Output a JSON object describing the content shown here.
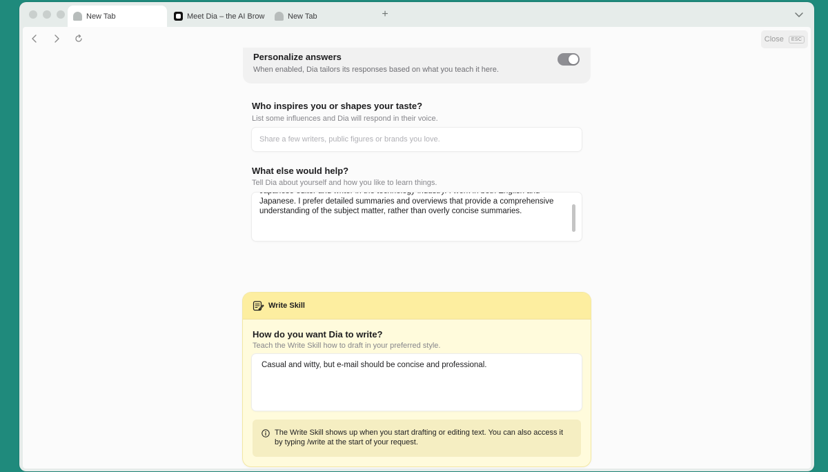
{
  "tabs": [
    {
      "label": "New Tab",
      "icon": "ghost-icon",
      "active": true
    },
    {
      "label": "Meet Dia – the AI Brow",
      "icon": "dia-icon",
      "active": false
    },
    {
      "label": "New Tab",
      "icon": "ghost-icon",
      "active": false
    }
  ],
  "new_tab_symbol": "+",
  "toolbar": {
    "close_label": "Close",
    "esc_key": "ESC"
  },
  "personalize": {
    "title": "Personalize answers",
    "description": "When enabled, Dia tailors its responses based on what you teach it here.",
    "enabled": true
  },
  "inspires": {
    "title": "Who inspires you or shapes your taste?",
    "subtitle": "List some influences and Dia will respond in their voice.",
    "placeholder": "Share a few writers, public figures or brands you love.",
    "value": ""
  },
  "else_help": {
    "title": "What else would help?",
    "subtitle": "Tell Dia about yourself and how you like to learn things.",
    "value": "Japanese editor and writer in the technology industry. I work in both English and Japanese. I prefer detailed summaries and overviews that provide a comprehensive understanding of the subject matter, rather than overly concise summaries."
  },
  "write_skill": {
    "header_label": "Write Skill",
    "title": "How do you want Dia to write?",
    "subtitle": "Teach the Write Skill how to draft in your preferred style.",
    "value": "Casual and witty, but e-mail should be concise and professional.",
    "info": "The Write Skill shows up when you start drafting or editing text. You can also access it by typing /write at the start of your request."
  },
  "colors": {
    "background": "#1f8a7c",
    "skill_header": "#fdeea0",
    "skill_body": "#fffbdc",
    "info_box": "#f5eec2"
  }
}
